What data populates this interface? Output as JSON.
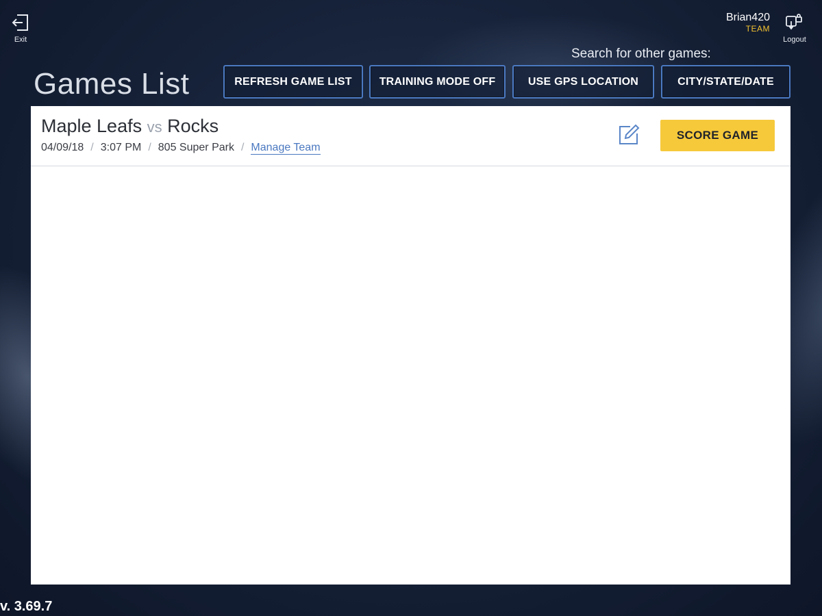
{
  "header": {
    "exit_label": "Exit",
    "user_name": "Brian420",
    "user_role": "TEAM",
    "logout_label": "Logout",
    "search_label": "Search for other games:"
  },
  "page": {
    "title": "Games List"
  },
  "toolbar": {
    "refresh_label": "REFRESH GAME LIST",
    "training_label": "TRAINING MODE OFF",
    "gps_label": "USE GPS LOCATION",
    "city_label": "CITY/STATE/DATE"
  },
  "games": [
    {
      "home": "Maple Leafs",
      "vs": "vs",
      "away": "Rocks",
      "date": "04/09/18",
      "time": "3:07 PM",
      "location": "805 Super Park",
      "manage_label": "Manage Team",
      "separator": "/",
      "score_label": "SCORE GAME",
      "edit_icon": "edit-icon"
    }
  ],
  "footer": {
    "version": "v. 3.69.7"
  },
  "colors": {
    "accent_yellow": "#f6c93b",
    "button_border": "#4b7ac2",
    "link": "#4a78c0",
    "role": "#f2c230"
  }
}
